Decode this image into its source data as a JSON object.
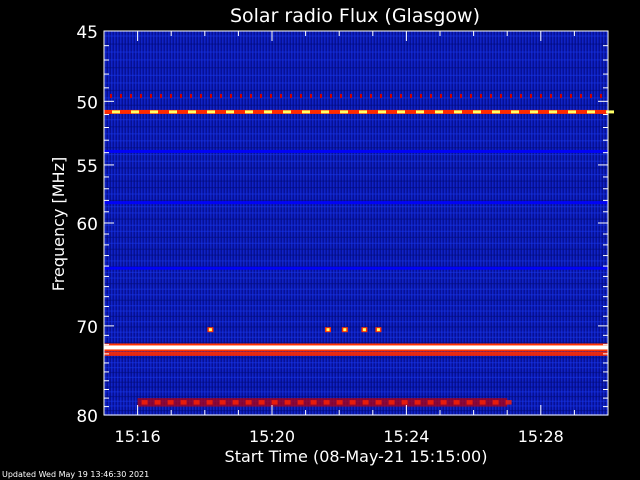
{
  "chart_data": {
    "type": "heatmap",
    "title": "Solar radio Flux (Glasgow)",
    "xlabel": "Start Time (08-May-21 15:15:00)",
    "ylabel": "Frequency [MHz]",
    "x_unit": "time (HH:MM, 08-May-21)",
    "xlim": [
      "15:15:00",
      "15:30:00"
    ],
    "ylim": [
      45,
      80
    ],
    "x_ticks": [
      "15:16",
      "15:20",
      "15:24",
      "15:28"
    ],
    "y_ticks": [
      45,
      50,
      55,
      60,
      70,
      80
    ],
    "colormap": [
      "#00003a",
      "#0008c0",
      "#1a40ff",
      "#c00000",
      "#ff3300",
      "#ffff66",
      "#ffffff"
    ],
    "background_color": "#0a18b0",
    "features": [
      {
        "kind": "band",
        "freq_mhz": 49.6,
        "intensity": "moderate",
        "note": "periodic red ticks"
      },
      {
        "kind": "band",
        "freq_mhz": 50.8,
        "intensity": "high",
        "note": "persistent yellow/red line"
      },
      {
        "kind": "band",
        "freq_mhz": 53.9,
        "intensity": "low"
      },
      {
        "kind": "band",
        "freq_mhz": 58.2,
        "intensity": "low"
      },
      {
        "kind": "band",
        "freq_mhz": 64.2,
        "intensity": "low"
      },
      {
        "kind": "burst",
        "freq_mhz": 70.4,
        "times": [
          "15:18:10",
          "15:21:40",
          "15:22:10",
          "15:22:45",
          "15:23:10"
        ]
      },
      {
        "kind": "band",
        "freq_mhz": 72.3,
        "intensity": "very high",
        "note": "saturated white line"
      },
      {
        "kind": "band",
        "freq_mhz": 73.0,
        "intensity": "high"
      },
      {
        "kind": "region",
        "freq_range_mhz": [
          78.0,
          79.0
        ],
        "time_range": [
          "15:16:00",
          "15:27:00"
        ],
        "intensity": "moderate"
      }
    ]
  },
  "footer": {
    "updated": "Updated Wed May 19 13:46:30 2021"
  }
}
